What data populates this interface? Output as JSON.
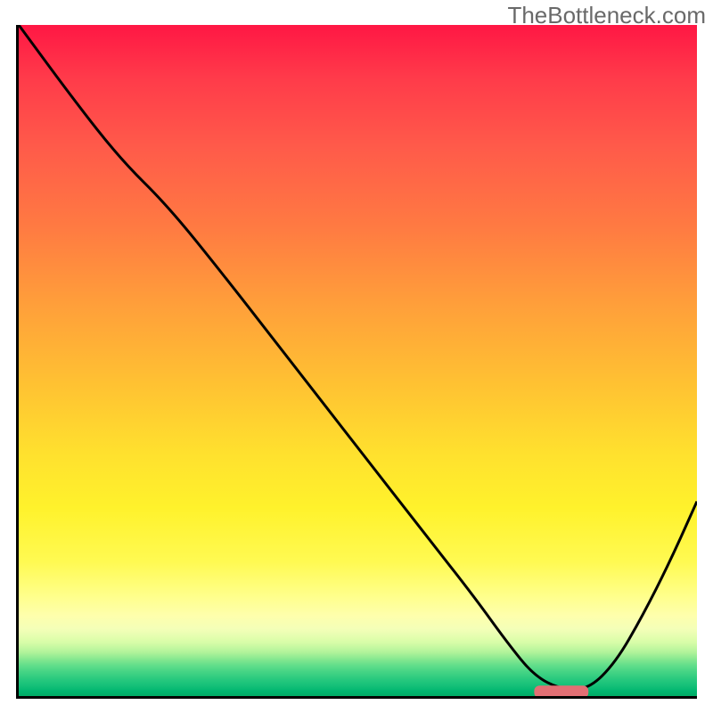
{
  "watermark": "TheBottleneck.com",
  "chart_data": {
    "type": "line",
    "title": "",
    "xlabel": "",
    "ylabel": "",
    "xlim": [
      0,
      100
    ],
    "ylim": [
      0,
      100
    ],
    "x": [
      0,
      8,
      15,
      22,
      30,
      40,
      50,
      60,
      67,
      72,
      76,
      80,
      84,
      88,
      92,
      96,
      100
    ],
    "values": [
      100,
      89,
      80,
      73,
      63,
      50,
      37,
      24,
      15,
      8,
      3,
      1,
      1,
      5,
      12,
      20,
      29
    ],
    "marker": {
      "x_start": 76,
      "x_end": 84,
      "y": 0.5
    },
    "background": "rainbow-gradient-red-to-green"
  }
}
